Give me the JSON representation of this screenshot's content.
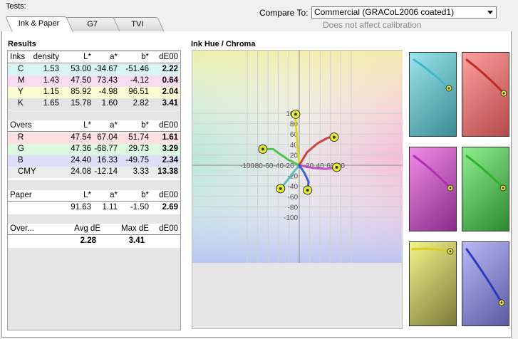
{
  "header": {
    "tests_label": "Tests:",
    "compare_label": "Compare To:",
    "compare_value": "Commercial (GRACoL2006 coated1)",
    "compare_note": "Does not affect calibration"
  },
  "tabs": [
    {
      "label": "Ink & Paper",
      "active": true
    },
    {
      "label": "G7",
      "active": false
    },
    {
      "label": "TVI",
      "active": false
    }
  ],
  "results": {
    "title": "Results",
    "inks": {
      "headers": [
        "Inks",
        "density",
        "L*",
        "a*",
        "b*",
        "dE00"
      ],
      "rows": [
        {
          "name": "C",
          "density": "1.53",
          "L": "53.00",
          "a": "-34.67",
          "b": "-51.46",
          "dE": "2.22",
          "color": "#d8f4f6"
        },
        {
          "name": "M",
          "density": "1.43",
          "L": "47.50",
          "a": "73.43",
          "b": "-4.12",
          "dE": "0.64",
          "color": "#f8dcef"
        },
        {
          "name": "Y",
          "density": "1.15",
          "L": "85.92",
          "a": "-4.98",
          "b": "96.51",
          "dE": "2.04",
          "color": "#fbfbd4"
        },
        {
          "name": "K",
          "density": "1.65",
          "L": "15.78",
          "a": "1.60",
          "b": "2.82",
          "dE": "3.41",
          "color": "#e4e4e4"
        }
      ]
    },
    "overs": {
      "headers": [
        "Overs",
        "L*",
        "a*",
        "b*",
        "dE00"
      ],
      "rows": [
        {
          "name": "R",
          "L": "47.54",
          "a": "67.04",
          "b": "51.74",
          "dE": "1.61",
          "color": "#fde0e0"
        },
        {
          "name": "G",
          "L": "47.36",
          "a": "-68.77",
          "b": "29.73",
          "dE": "3.29",
          "color": "#dcf8de"
        },
        {
          "name": "B",
          "L": "24.40",
          "a": "16.33",
          "b": "-49.75",
          "dE": "2.34",
          "color": "#dfdff9"
        },
        {
          "name": "CMY",
          "L": "24.08",
          "a": "-12.14",
          "b": "3.33",
          "dE": "13.38",
          "color": "#ececec"
        }
      ]
    },
    "paper": {
      "headers": [
        "Paper",
        "L*",
        "a*",
        "b*",
        "dE00"
      ],
      "row": {
        "L": "91.63",
        "a": "1.11",
        "b": "-1.50",
        "dE": "2.69"
      }
    },
    "overall": {
      "headers": [
        "Over...",
        "Avg dE",
        "Max dE",
        "dE00"
      ],
      "row": {
        "avg": "2.28",
        "max": "3.41"
      }
    }
  },
  "chart_data": {
    "type": "line",
    "title": "Ink Hue / Chroma",
    "xlabel": "",
    "ylabel": "",
    "xlim": [
      -110,
      110
    ],
    "ylim": [
      -110,
      110
    ],
    "xticks": [
      -100,
      -80,
      -60,
      -40,
      -20,
      0,
      20,
      40,
      60,
      80
    ],
    "yticks": [
      100,
      80,
      60,
      40,
      20,
      -20,
      -40,
      -60,
      -80,
      -100
    ],
    "grid": true,
    "series": [
      {
        "color": "#d8d820",
        "points": [
          [
            0,
            0
          ],
          [
            -3,
            30
          ],
          [
            -5,
            60
          ],
          [
            -7,
            80
          ],
          [
            -7,
            98
          ]
        ]
      },
      {
        "color": "#d03030",
        "points": [
          [
            0,
            0
          ],
          [
            15,
            25
          ],
          [
            35,
            42
          ],
          [
            55,
            53
          ],
          [
            67,
            55
          ]
        ]
      },
      {
        "color": "#40c040",
        "points": [
          [
            0,
            0
          ],
          [
            -20,
            10
          ],
          [
            -38,
            22
          ],
          [
            -50,
            31
          ],
          [
            -70,
            31
          ]
        ]
      },
      {
        "color": "#50b8c0",
        "points": [
          [
            0,
            0
          ],
          [
            -10,
            -12
          ],
          [
            -22,
            -28
          ],
          [
            -36,
            -45
          ]
        ]
      },
      {
        "color": "#c040c0",
        "points": [
          [
            0,
            0
          ],
          [
            25,
            -5
          ],
          [
            50,
            -7
          ],
          [
            72,
            -5
          ]
        ]
      },
      {
        "color": "#3050d0",
        "points": [
          [
            0,
            0
          ],
          [
            10,
            -15
          ],
          [
            18,
            -32
          ],
          [
            16,
            -48
          ]
        ]
      }
    ],
    "endpoints": [
      [
        -7,
        98
      ],
      [
        67,
        54
      ],
      [
        -70,
        31
      ],
      [
        -36,
        -45
      ],
      [
        72,
        -4
      ],
      [
        16,
        -48
      ]
    ]
  },
  "thumbnails": [
    {
      "name": "cyan",
      "line": "#40b8c8",
      "bg_top": "#9ae6ee",
      "bg_bottom": "#3e8a94"
    },
    {
      "name": "red",
      "line": "#c02a2a",
      "bg_top": "#ff9f9f",
      "bg_bottom": "#b54a4a"
    },
    {
      "name": "magenta",
      "line": "#b030b0",
      "bg_top": "#f08ae8",
      "bg_bottom": "#8a2d8a"
    },
    {
      "name": "green",
      "line": "#30b030",
      "bg_top": "#8fee8f",
      "bg_bottom": "#2b8a2b"
    },
    {
      "name": "yellow",
      "line": "#d8d020",
      "bg_top": "#f4f48a",
      "bg_bottom": "#7a7a3a"
    },
    {
      "name": "blue",
      "line": "#2a3ac0",
      "bg_top": "#b8b8f8",
      "bg_bottom": "#5a5aa0"
    }
  ]
}
